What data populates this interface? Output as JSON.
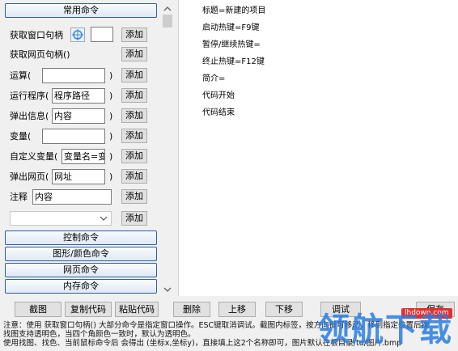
{
  "left_panel": {
    "common_section": "常用命令",
    "rows": [
      {
        "label": "获取窗口句柄",
        "button": "添加"
      },
      {
        "label": "获取网页句柄()",
        "button": "添加"
      },
      {
        "label": "运算(",
        "value": "",
        "close": ")",
        "button": "添加"
      },
      {
        "label": "运行程序(",
        "value": "程序路径",
        "close": ")",
        "button": "添加"
      },
      {
        "label": "弹出信息(",
        "value": "内容",
        "close": ")",
        "button": "添加"
      },
      {
        "label": "变量(",
        "value": "",
        "close": ")",
        "button": "添加"
      },
      {
        "label": "自定义变量(",
        "value": "变量名=变量",
        "close": ")",
        "button": "添加"
      },
      {
        "label": "弹出网页(",
        "value": "网址",
        "close": ")",
        "button": "添加"
      },
      {
        "label": "注释",
        "value": "内容",
        "button": "添加"
      },
      {
        "dropdown_value": "",
        "button": "添加"
      }
    ],
    "sections": [
      "控制命令",
      "图形/颜色命令",
      "网页命令",
      "内存命令"
    ]
  },
  "editor": {
    "lines": [
      "标题=新建的项目",
      "启动热键=F9键",
      "暂停/继续热键=",
      "终止热键=F12键",
      "简介=",
      "代码开始",
      "代码结束"
    ]
  },
  "toolbar": {
    "screenshot": "截图",
    "copy_code": "复制代码",
    "paste_code": "粘贴代码",
    "delete": "删除",
    "move_up": "上移",
    "move_down": "下移",
    "debug": "调试",
    "save": "保存"
  },
  "notes": [
    "注意：使用 获取窗口句柄() 大部分命令是指定窗口操作。ESC键取消调试。截图内标签，按方向键可移动，移到指定位置后按",
    "找图支持透明色，当四个角颜色一致时，默认为透明色。",
    "使用找图、找色、当前鼠标命令后 会得出 (坐标x,坐标y)，直接填上这2个名称即可，图片默认在根目录/tu/图片.bmp"
  ],
  "watermark": {
    "site": "lhdown.com",
    "brand": "领航下载"
  },
  "colors": {
    "section_border": "#2f5e9c",
    "watermark": "#2a7de1",
    "watermark_red": "#e03030"
  }
}
